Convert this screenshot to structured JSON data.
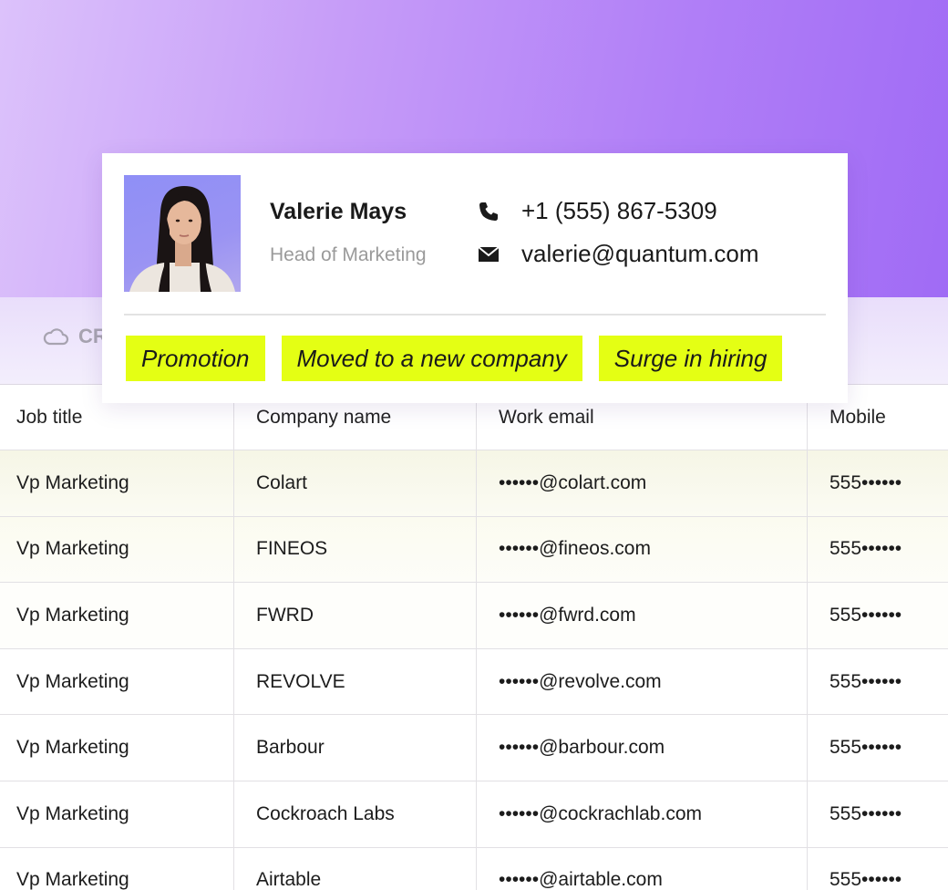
{
  "crm_tab": {
    "label": "CR"
  },
  "table": {
    "headers": [
      "Job title",
      "Company name",
      "Work email",
      "Mobile"
    ],
    "rows": [
      [
        "Vp Marketing",
        "Colart",
        "••••••@colart.com",
        "555••••••"
      ],
      [
        "Vp Marketing",
        "FINEOS",
        "••••••@fineos.com",
        "555••••••"
      ],
      [
        "Vp Marketing",
        "FWRD",
        "••••••@fwrd.com",
        "555••••••"
      ],
      [
        "Vp Marketing",
        "REVOLVE",
        "••••••@revolve.com",
        "555••••••"
      ],
      [
        "Vp Marketing",
        "Barbour",
        "••••••@barbour.com",
        "555••••••"
      ],
      [
        "Vp Marketing",
        "Cockroach Labs",
        "••••••@cockrachlab.com",
        "555••••••"
      ],
      [
        "Vp Marketing",
        "Airtable",
        "••••••@airtable.com",
        "555••••••"
      ]
    ]
  },
  "card": {
    "name": "Valerie Mays",
    "role": "Head of Marketing",
    "phone": "+1 (555) 867-5309",
    "email": "valerie@quantum.com",
    "phone_icon": "phone-icon",
    "email_icon": "mail-icon",
    "tags": [
      "Promotion",
      "Moved to a new company",
      "Surge in hiring"
    ]
  },
  "colors": {
    "tag_bg": "#e4ff14",
    "hero_start": "#dcc2fb",
    "hero_end": "#a06bf5"
  }
}
